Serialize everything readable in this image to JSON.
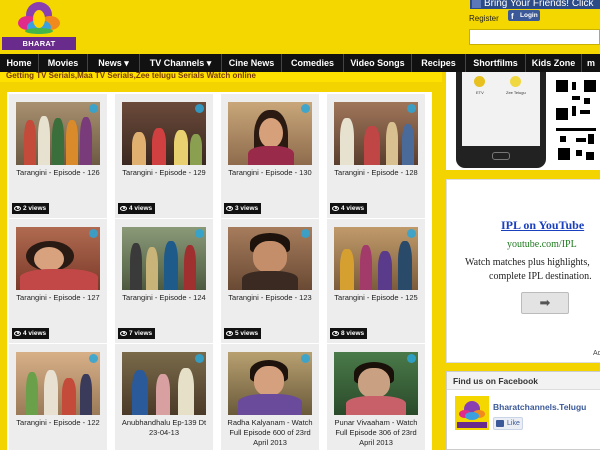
{
  "header": {
    "logo_text": "BHARAT CHANNELS",
    "facebook_banner": "Bring Your Friends! Click",
    "register_label": "Register",
    "fb_login_label": "Login",
    "fb_login_icon": "f"
  },
  "nav": {
    "items": [
      {
        "label": "Home"
      },
      {
        "label": "Movies"
      },
      {
        "label": "News ▾"
      },
      {
        "label": "TV Channels ▾"
      },
      {
        "label": "Cine News"
      },
      {
        "label": "Comedies"
      },
      {
        "label": "Video Songs"
      },
      {
        "label": "Recipes"
      },
      {
        "label": "Shortfilms"
      },
      {
        "label": "Kids Zone"
      },
      {
        "label": "m"
      }
    ]
  },
  "ticker": {
    "text": "Getting TV Serials,Maa TV Serials,Zee telugu Serials Watch online"
  },
  "videos": [
    {
      "title": "Tarangini - Episode - 126",
      "views": "2 views"
    },
    {
      "title": "Tarangini - Episode - 129",
      "views": "4 views"
    },
    {
      "title": "Tarangini - Episode - 130",
      "views": "3 views"
    },
    {
      "title": "Tarangini - Episode - 128",
      "views": "4 views"
    },
    {
      "title": "Tarangini - Episode - 127",
      "views": "4 views"
    },
    {
      "title": "Tarangini - Episode - 124",
      "views": "7 views"
    },
    {
      "title": "Tarangini - Episode - 123",
      "views": "5 views"
    },
    {
      "title": "Tarangini - Episode - 125",
      "views": "8 views"
    },
    {
      "title": "Tarangini - Episode - 122",
      "views": ""
    },
    {
      "title": "Anubhandhalu Ep-139 Dt 23-04-13",
      "views": ""
    },
    {
      "title": "Radha Kalyanam - Watch Full Episode 600 of 23rd April 2013",
      "views": ""
    },
    {
      "title": "Punar Vivaaham - Watch Full Episode 306 of 23rd April 2013",
      "views": ""
    }
  ],
  "sidebar": {
    "app_labels": [
      "ETV",
      "Zee Telugu"
    ],
    "ipl": {
      "title": "IPL on YouTube",
      "url": "youtube.com/IPL",
      "line1": "Watch matches plus highlights,",
      "line2": "complete IPL destination.",
      "arrow": "➡",
      "ad_label": "Ad"
    },
    "facebook": {
      "header": "Find us on Facebook",
      "page_name": "Bharatchannels.Telugu",
      "like_label": "Like"
    }
  },
  "colors": {
    "brand_yellow": "#f5d700",
    "nav_black": "#111111",
    "ticker_text": "#7a3b00",
    "facebook_blue": "#3b5998",
    "ad_link_blue": "#1a3fbf"
  }
}
